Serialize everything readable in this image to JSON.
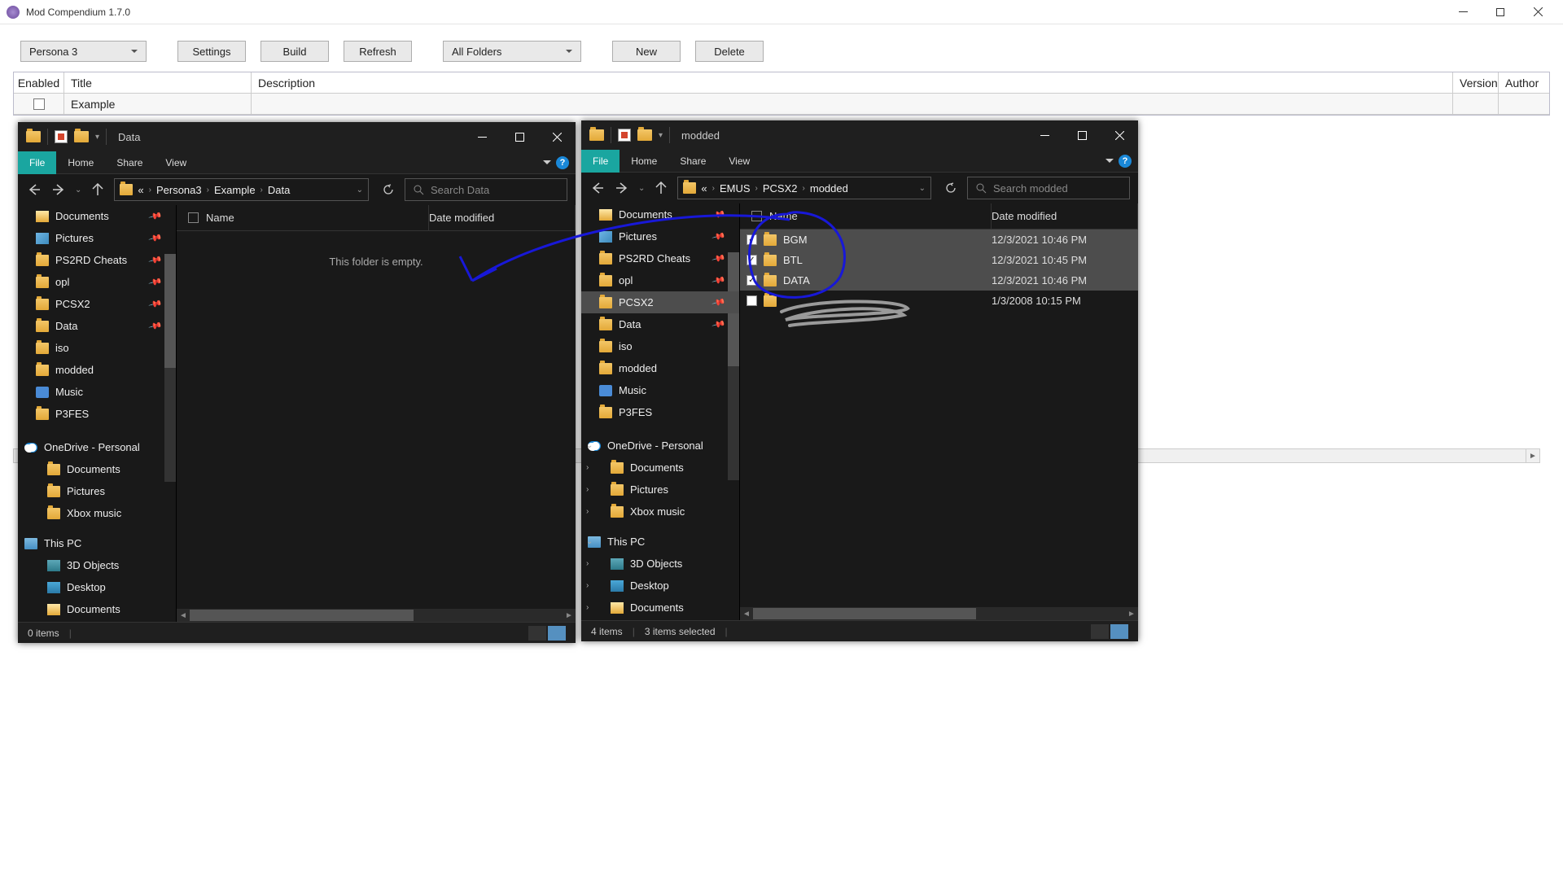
{
  "app": {
    "title": "Mod Compendium 1.7.0",
    "winctrl": {
      "min": "—",
      "max": "☐",
      "close": "✕"
    }
  },
  "toolbar": {
    "game_dd": "Persona 3",
    "settings": "Settings",
    "build": "Build",
    "refresh": "Refresh",
    "folders_dd": "All Folders",
    "new": "New",
    "delete": "Delete"
  },
  "grid": {
    "headers": {
      "enabled": "Enabled",
      "title": "Title",
      "desc": "Description",
      "version": "Version",
      "author": "Author"
    },
    "rows": [
      {
        "enabled": false,
        "title": "Example",
        "desc": "",
        "version": "",
        "author": ""
      }
    ]
  },
  "explorerLeft": {
    "title": "Data",
    "ribbon": {
      "file": "File",
      "home": "Home",
      "share": "Share",
      "view": "View"
    },
    "breadcrumb": [
      "«",
      "Persona3",
      "Example",
      "Data"
    ],
    "searchPlaceholder": "Search Data",
    "columns": {
      "name": "Name",
      "date": "Date modified"
    },
    "emptyMsg": "This folder is empty.",
    "nav": [
      {
        "label": "Documents",
        "icon": "docs",
        "pin": true
      },
      {
        "label": "Pictures",
        "icon": "pics",
        "pin": true
      },
      {
        "label": "PS2RD Cheats",
        "icon": "folder",
        "pin": true
      },
      {
        "label": "opl",
        "icon": "folder",
        "pin": true
      },
      {
        "label": "PCSX2",
        "icon": "folder",
        "pin": true
      },
      {
        "label": "Data",
        "icon": "folder",
        "pin": true
      },
      {
        "label": "iso",
        "icon": "folder"
      },
      {
        "label": "modded",
        "icon": "folder"
      },
      {
        "label": "Music",
        "icon": "music"
      },
      {
        "label": "P3FES",
        "icon": "folder"
      }
    ],
    "navGroups": [
      {
        "label": "OneDrive - Personal",
        "icon": "cloud",
        "children": [
          {
            "label": "Documents",
            "icon": "folder"
          },
          {
            "label": "Pictures",
            "icon": "folder"
          },
          {
            "label": "Xbox music",
            "icon": "folder"
          }
        ]
      },
      {
        "label": "This PC",
        "icon": "pc",
        "children": [
          {
            "label": "3D Objects",
            "icon": "3d"
          },
          {
            "label": "Desktop",
            "icon": "desk"
          },
          {
            "label": "Documents",
            "icon": "docs"
          }
        ]
      }
    ],
    "status": {
      "count": "0 items"
    }
  },
  "explorerRight": {
    "title": "modded",
    "ribbon": {
      "file": "File",
      "home": "Home",
      "share": "Share",
      "view": "View"
    },
    "breadcrumb": [
      "«",
      "EMUS",
      "PCSX2",
      "modded"
    ],
    "searchPlaceholder": "Search modded",
    "columns": {
      "name": "Name",
      "date": "Date modified"
    },
    "rows": [
      {
        "checked": true,
        "name": "BGM",
        "date": "12/3/2021 10:46 PM",
        "icon": "folder",
        "sel": true
      },
      {
        "checked": true,
        "name": "BTL",
        "date": "12/3/2021 10:45 PM",
        "icon": "folder",
        "sel": true
      },
      {
        "checked": true,
        "name": "DATA",
        "date": "12/3/2021 10:46 PM",
        "icon": "folder",
        "sel": true
      },
      {
        "checked": false,
        "name": "",
        "date": "1/3/2008 10:15 PM",
        "icon": "file",
        "sel": false,
        "redacted": true
      }
    ],
    "nav": [
      {
        "label": "Documents",
        "icon": "docs",
        "pin": true
      },
      {
        "label": "Pictures",
        "icon": "pics",
        "pin": true
      },
      {
        "label": "PS2RD Cheats",
        "icon": "folder",
        "pin": true
      },
      {
        "label": "opl",
        "icon": "folder",
        "pin": true
      },
      {
        "label": "PCSX2",
        "icon": "folder",
        "pin": true,
        "selected": true
      },
      {
        "label": "Data",
        "icon": "folder",
        "pin": true
      },
      {
        "label": "iso",
        "icon": "folder"
      },
      {
        "label": "modded",
        "icon": "folder"
      },
      {
        "label": "Music",
        "icon": "music"
      },
      {
        "label": "P3FES",
        "icon": "folder"
      }
    ],
    "navGroups": [
      {
        "label": "OneDrive - Personal",
        "icon": "cloud",
        "expanded": true,
        "children": [
          {
            "label": "Documents",
            "icon": "folder"
          },
          {
            "label": "Pictures",
            "icon": "folder"
          },
          {
            "label": "Xbox music",
            "icon": "folder"
          }
        ]
      },
      {
        "label": "This PC",
        "icon": "pc",
        "expanded": true,
        "children": [
          {
            "label": "3D Objects",
            "icon": "3d"
          },
          {
            "label": "Desktop",
            "icon": "desk"
          },
          {
            "label": "Documents",
            "icon": "docs"
          }
        ]
      }
    ],
    "status": {
      "count": "4 items",
      "sel": "3 items selected"
    }
  }
}
